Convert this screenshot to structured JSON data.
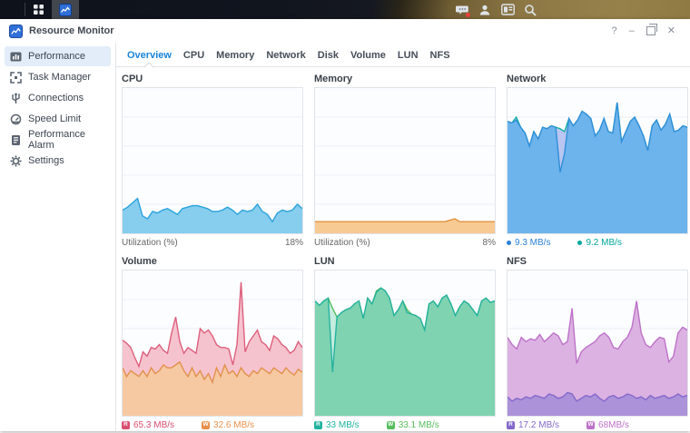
{
  "taskbar": {
    "icons": [
      "show-desktop",
      "main-menu",
      "resource-monitor-app"
    ],
    "tray": [
      "notifications-chat",
      "user",
      "widgets",
      "search"
    ],
    "notification_badge_color": "#e8413c"
  },
  "window": {
    "title": "Resource Monitor",
    "controls": {
      "help": "?",
      "minimize": "–",
      "close": "✕"
    }
  },
  "sidebar": {
    "items": [
      {
        "label": "Performance",
        "selected": true
      },
      {
        "label": "Task Manager",
        "selected": false
      },
      {
        "label": "Connections",
        "selected": false
      },
      {
        "label": "Speed Limit",
        "selected": false
      },
      {
        "label": "Performance Alarm",
        "selected": false
      },
      {
        "label": "Settings",
        "selected": false
      }
    ]
  },
  "tabs": {
    "items": [
      "Overview",
      "CPU",
      "Memory",
      "Network",
      "Disk",
      "Volume",
      "LUN",
      "NFS"
    ],
    "active": "Overview",
    "active_color": "#1a84d9"
  },
  "chart_data": [
    {
      "type": "area",
      "title": "CPU",
      "ylim": [
        0,
        100
      ],
      "grid": true,
      "series": [
        {
          "name": "utilization",
          "stroke": "#2ba3dc",
          "fill": "#86cdee",
          "values": [
            16,
            18,
            21,
            24,
            12,
            10,
            15,
            14,
            16,
            17,
            15,
            13,
            17,
            18,
            19,
            19,
            18,
            17,
            15,
            15,
            16,
            18,
            16,
            13,
            16,
            15,
            16,
            20,
            15,
            13,
            8,
            14,
            16,
            15,
            16,
            20,
            17
          ]
        }
      ],
      "footer": {
        "kind": "utilization",
        "label": "Utilization  (%)",
        "value": "18%"
      }
    },
    {
      "type": "area",
      "title": "Memory",
      "ylim": [
        0,
        100
      ],
      "grid": true,
      "series": [
        {
          "name": "utilization",
          "stroke": "#e2913f",
          "fill": "#f8ca93",
          "values": [
            8,
            8,
            8,
            8,
            8,
            8,
            8,
            8,
            8,
            8,
            8,
            8,
            8,
            8,
            8,
            8,
            8,
            8,
            8,
            8,
            8,
            8,
            8,
            8,
            8,
            8,
            8,
            9,
            10,
            8,
            8,
            8,
            8,
            8,
            8,
            8,
            8
          ]
        }
      ],
      "footer": {
        "kind": "utilization",
        "label": "Utilization  (%)",
        "value": "8%"
      }
    },
    {
      "type": "area",
      "title": "Network",
      "ylim": [
        0,
        100
      ],
      "grid": true,
      "series": [
        {
          "name": "received",
          "stroke": "#19b2a6",
          "fill": "#b9c6f1",
          "values": [
            77,
            76,
            80,
            73,
            69,
            60,
            70,
            65,
            73,
            72,
            74,
            73,
            72,
            70,
            79,
            74,
            78,
            84,
            82,
            79,
            67,
            71,
            79,
            70,
            69,
            90,
            63,
            70,
            77,
            80,
            74,
            67,
            57,
            74,
            78,
            71,
            75,
            82,
            70,
            71,
            74,
            73
          ]
        },
        {
          "name": "sent",
          "stroke": "#2f8fd8",
          "fill": "#6db3ec",
          "values": [
            77,
            76,
            78,
            73,
            69,
            60,
            70,
            65,
            73,
            72,
            74,
            73,
            42,
            55,
            79,
            74,
            78,
            84,
            82,
            79,
            67,
            71,
            79,
            70,
            69,
            90,
            63,
            70,
            77,
            80,
            74,
            67,
            57,
            74,
            78,
            71,
            75,
            82,
            70,
            71,
            74,
            73
          ]
        }
      ],
      "footer": {
        "kind": "legend",
        "items": [
          {
            "marker": "dot",
            "color": "#2a80d5",
            "text": "9.3 MB/s"
          },
          {
            "marker": "dot",
            "color": "#00a89b",
            "text": "9.2 MB/s"
          }
        ]
      }
    },
    {
      "type": "area",
      "title": "Volume",
      "ylim": [
        0,
        100
      ],
      "grid": true,
      "series": [
        {
          "name": "read",
          "stroke": "#dd5f7d",
          "fill": "#f5c3cd",
          "values": [
            52,
            50,
            47,
            40,
            34,
            44,
            41,
            47,
            46,
            49,
            45,
            43,
            57,
            68,
            51,
            43,
            47,
            45,
            43,
            60,
            57,
            59,
            55,
            49,
            47,
            47,
            46,
            35,
            49,
            92,
            44,
            51,
            55,
            59,
            51,
            49,
            45,
            55,
            53,
            49,
            47,
            43,
            45,
            51,
            47
          ]
        },
        {
          "name": "write",
          "stroke": "#e2914d",
          "fill": "#f6c9a3",
          "values": [
            33,
            27,
            31,
            29,
            27,
            31,
            27,
            33,
            29,
            31,
            35,
            33,
            33,
            35,
            37,
            31,
            27,
            33,
            27,
            31,
            25,
            29,
            23,
            33,
            27,
            35,
            29,
            31,
            27,
            33,
            29,
            27,
            31,
            29,
            33,
            31,
            29,
            33,
            31,
            29,
            33,
            30,
            28,
            32,
            30
          ]
        }
      ],
      "footer": {
        "kind": "legend",
        "items": [
          {
            "marker": "R",
            "color": "#d94f6e",
            "text": "65.3 MB/s"
          },
          {
            "marker": "W",
            "color": "#e8914d",
            "text": "32.6 MB/s"
          }
        ]
      }
    },
    {
      "type": "area",
      "title": "LUN",
      "ylim": [
        0,
        100
      ],
      "grid": true,
      "series": [
        {
          "name": "write",
          "stroke": "#56bd5c",
          "fill": "#c6ecdf",
          "values": [
            79,
            76,
            79,
            81,
            74,
            68,
            71,
            73,
            74,
            77,
            79,
            67,
            81,
            77,
            86,
            88,
            86,
            81,
            69,
            73,
            79,
            73,
            70,
            69,
            67,
            59,
            77,
            79,
            75,
            81,
            83,
            77,
            69,
            75,
            79,
            77,
            73,
            69,
            79,
            81,
            78,
            79
          ]
        },
        {
          "name": "read",
          "stroke": "#25b29e",
          "fill": "#7fd3b1",
          "values": [
            79,
            76,
            79,
            81,
            30,
            68,
            71,
            73,
            74,
            77,
            79,
            67,
            81,
            77,
            85,
            88,
            86,
            81,
            69,
            73,
            79,
            71,
            70,
            69,
            67,
            59,
            77,
            79,
            75,
            81,
            83,
            77,
            69,
            75,
            79,
            77,
            73,
            69,
            79,
            81,
            78,
            79
          ]
        }
      ],
      "footer": {
        "kind": "legend",
        "items": [
          {
            "marker": "R",
            "color": "#1fb3a0",
            "text": "33 MB/s"
          },
          {
            "marker": "W",
            "color": "#56bd5c",
            "text": "33.1 MB/s"
          }
        ]
      }
    },
    {
      "type": "area",
      "title": "NFS",
      "ylim": [
        0,
        100
      ],
      "grid": true,
      "series": [
        {
          "name": "write",
          "stroke": "#bd72c8",
          "fill": "#dcb2e2",
          "values": [
            54,
            49,
            46,
            54,
            51,
            53,
            52,
            56,
            51,
            54,
            57,
            55,
            49,
            51,
            74,
            36,
            44,
            47,
            49,
            51,
            55,
            57,
            54,
            47,
            46,
            51,
            54,
            61,
            79,
            57,
            49,
            47,
            51,
            54,
            53,
            37,
            41,
            57,
            61,
            59
          ]
        },
        {
          "name": "read",
          "stroke": "#8468cc",
          "fill": "#ab92d9",
          "values": [
            13,
            10,
            12,
            11,
            13,
            12,
            14,
            13,
            12,
            15,
            14,
            12,
            13,
            16,
            15,
            10,
            12,
            14,
            13,
            15,
            12,
            10,
            13,
            14,
            12,
            13,
            15,
            14,
            12,
            13,
            11,
            14,
            12,
            13,
            14,
            12,
            13,
            15,
            13,
            14
          ]
        }
      ],
      "footer": {
        "kind": "legend",
        "items": [
          {
            "marker": "R",
            "color": "#8468cc",
            "text": "17.2 MB/s"
          },
          {
            "marker": "W",
            "color": "#bd72c8",
            "text": "68MB/s"
          }
        ]
      }
    }
  ]
}
